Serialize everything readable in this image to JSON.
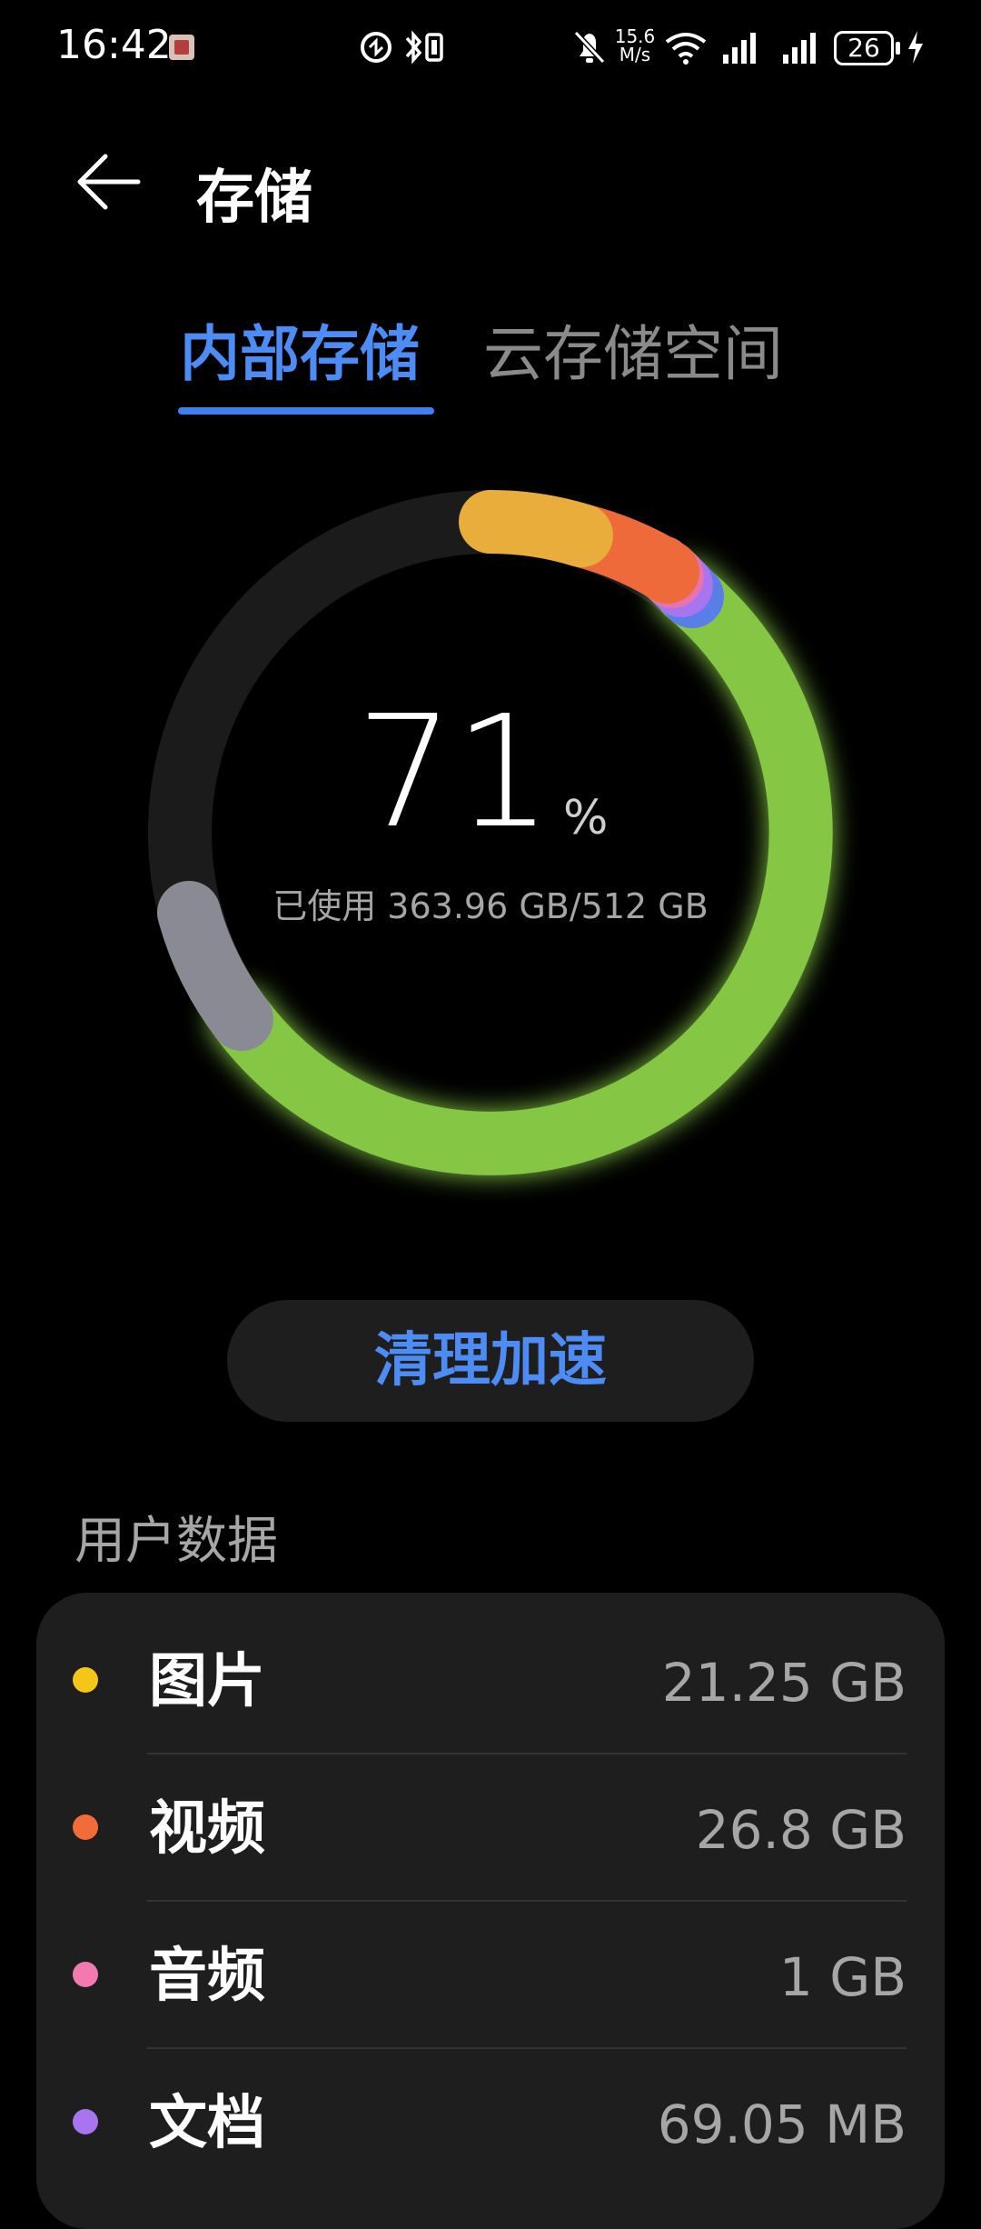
{
  "status_bar": {
    "time": "16:42",
    "speed_value": "15.6",
    "speed_unit": "M/s",
    "battery": "26"
  },
  "header": {
    "title": "存储"
  },
  "tabs": [
    {
      "label": "内部存储",
      "active": true
    },
    {
      "label": "云存储空间",
      "active": false
    }
  ],
  "storage": {
    "percent": "71",
    "percent_sign": "%",
    "used_label": "已使用 363.96 GB/512 GB"
  },
  "clean_button": {
    "label": "清理加速"
  },
  "user_data": {
    "title": "用户数据",
    "items": [
      {
        "label": "图片",
        "value": "21.25 GB",
        "color": "#f5c518"
      },
      {
        "label": "视频",
        "value": "26.8 GB",
        "color": "#f26b3a"
      },
      {
        "label": "音频",
        "value": "1 GB",
        "color": "#f27ab0"
      },
      {
        "label": "文档",
        "value": "69.05 MB",
        "color": "#a874f0"
      }
    ]
  },
  "colors": {
    "accent": "#4d8bf5",
    "ring_track": "#1b1b1b",
    "ring_apps": "#85c744",
    "ring_images": "#e8ad3a",
    "ring_videos": "#ee6a3a",
    "ring_audio": "#e574b0",
    "ring_docs": "#a874f0",
    "ring_other": "#5a7ee8",
    "ring_system": "#8a8a94"
  }
}
